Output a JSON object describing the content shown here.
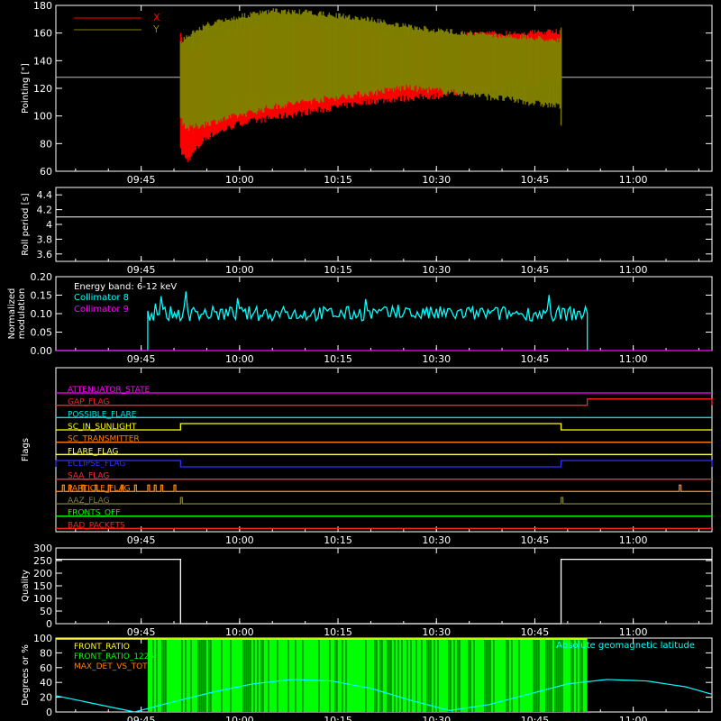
{
  "chart_data": [
    {
      "type": "line",
      "ylabel": "Pointing [\"]",
      "ylim": [
        60,
        180
      ],
      "yticks": [
        60,
        80,
        100,
        120,
        140,
        160,
        180
      ],
      "xlim": [
        "09:32",
        "11:12"
      ],
      "xticks": [
        "09:45",
        "10:00",
        "10:15",
        "10:30",
        "10:45",
        "11:00"
      ],
      "reference_line": 128,
      "legend_position": "top-left",
      "series": [
        {
          "name": "X",
          "color": "#ff0000",
          "x": [
            "09:51",
            "09:52",
            "09:55",
            "10:00",
            "10:10",
            "10:20",
            "10:25",
            "10:30",
            "10:40",
            "10:49"
          ],
          "high": [
            160,
            150,
            158,
            165,
            170,
            164,
            160,
            161,
            162,
            163
          ],
          "low": [
            72,
            65,
            82,
            92,
            100,
            108,
            110,
            112,
            118,
            123
          ]
        },
        {
          "name": "Y",
          "color": "#808000",
          "x": [
            "09:51",
            "09:52",
            "09:55",
            "10:00",
            "10:05",
            "10:10",
            "10:20",
            "10:25",
            "10:30",
            "10:40",
            "10:49"
          ],
          "high": [
            155,
            160,
            168,
            174,
            178,
            177,
            172,
            167,
            164,
            160,
            157
          ],
          "low": [
            96,
            88,
            92,
            98,
            104,
            108,
            114,
            118,
            116,
            110,
            104
          ]
        }
      ]
    },
    {
      "type": "line",
      "ylabel": "Roll period [s]",
      "ylim": [
        3.5,
        4.5
      ],
      "yticks": [
        3.6,
        3.8,
        4.0,
        4.2,
        4.4
      ],
      "xlim": [
        "09:32",
        "11:12"
      ],
      "xticks": [
        "09:45",
        "10:00",
        "10:15",
        "10:30",
        "10:45",
        "11:00"
      ],
      "series": [
        {
          "name": "",
          "color": "#ffffff",
          "x": [
            "09:32",
            "11:12"
          ],
          "y": [
            4.1,
            4.1
          ]
        }
      ]
    },
    {
      "type": "line",
      "ylabel_lines": [
        "Normalized",
        "modulation"
      ],
      "ylim": [
        0.0,
        0.2
      ],
      "yticks": [
        "0.00",
        "0.05",
        "0.10",
        "0.15",
        "0.20"
      ],
      "xlim": [
        "09:32",
        "11:12"
      ],
      "xticks": [
        "09:45",
        "10:00",
        "10:15",
        "10:30",
        "10:45",
        "11:00"
      ],
      "annotation": "Energy band: 6-12 keV",
      "legend_position": "top-left",
      "series": [
        {
          "name": "Collimator 8",
          "color": "#00ffff",
          "start": "09:46",
          "end": "10:53",
          "mean": 0.1,
          "spread": 0.04
        },
        {
          "name": "Collimator 9",
          "color": "#ff00ff",
          "y_constant": 0.0
        }
      ]
    },
    {
      "type": "line",
      "ylabel": "Flags",
      "xlim": [
        "09:32",
        "11:12"
      ],
      "xticks": [
        "09:45",
        "10:00",
        "10:15",
        "10:30",
        "10:45",
        "11:00"
      ],
      "flags": [
        {
          "name": "ATTENUATOR_STATE",
          "color": "#ff00ff",
          "steps": []
        },
        {
          "name": "GAP_FLAG",
          "color": "#ff2020",
          "steps": [
            {
              "from": "10:53",
              "to": "11:12"
            }
          ]
        },
        {
          "name": "POSSIBLE_FLARE",
          "color": "#00e0e0",
          "steps": []
        },
        {
          "name": "SC_IN_SUNLIGHT",
          "color": "#ffff00",
          "steps": [
            {
              "from": "09:51",
              "to": "10:49"
            }
          ]
        },
        {
          "name": "SC_TRANSMITTER",
          "color": "#ff8000",
          "steps": []
        },
        {
          "name": "FLARE_FLAG",
          "color": "#ffff60",
          "steps": []
        },
        {
          "name": "ECLIPSE_FLAG",
          "color": "#3030ff",
          "steps": [
            {
              "from": "09:32",
              "to": "09:51"
            },
            {
              "from": "10:49",
              "to": "11:12"
            }
          ]
        },
        {
          "name": "SAA_FLAG",
          "color": "#ff3030",
          "steps": []
        },
        {
          "name": "PARTICLE_FLAG",
          "color": "#ff8000",
          "pulse_times": [
            "09:33",
            "09:34",
            "09:36",
            "09:38",
            "09:40",
            "09:42",
            "09:44",
            "09:46",
            "09:47",
            "09:48",
            "09:50",
            "11:07"
          ]
        },
        {
          "name": "AAZ_FLAG",
          "color": "#808040",
          "pulse_times": [
            "09:51",
            "10:49"
          ]
        },
        {
          "name": "FRONTS_OFF",
          "color": "#00ff00",
          "steps": []
        },
        {
          "name": "BAD_PACKETS",
          "color": "#ff2020",
          "steps": []
        }
      ]
    },
    {
      "type": "line",
      "ylabel": "Quality",
      "ylim": [
        0,
        300
      ],
      "yticks": [
        0,
        50,
        100,
        150,
        200,
        250,
        300
      ],
      "xlim": [
        "09:32",
        "11:12"
      ],
      "xticks": [
        "09:45",
        "10:00",
        "10:15",
        "10:30",
        "10:45",
        "11:00"
      ],
      "series": [
        {
          "name": "",
          "color": "#ffffff",
          "x": [
            "09:32",
            "09:51",
            "09:51",
            "10:49",
            "10:49",
            "10:49",
            "11:12"
          ],
          "y": [
            255,
            255,
            0,
            0,
            30,
            255,
            255
          ]
        }
      ]
    },
    {
      "type": "line",
      "ylabel": "Degrees or %",
      "ylim": [
        0,
        100
      ],
      "yticks": [
        0,
        20,
        40,
        60,
        80,
        100
      ],
      "xlim": [
        "09:32",
        "11:12"
      ],
      "xticks": [
        "09:45",
        "10:00",
        "10:15",
        "10:30",
        "10:45",
        "11:00"
      ],
      "legend": [
        "FRONT_RATIO",
        "FRONT_RATIO_1225",
        "MAX_DET_VS_TOT"
      ],
      "legend_colors": [
        "#ffff00",
        "#00ff00",
        "#ff8000"
      ],
      "annotation": "Absolute geomagnetic latitude",
      "annotation_color": "#00ffff",
      "series": [
        {
          "name": "FRONT_RATIO_1225",
          "color": "#00ff00",
          "start": "09:46",
          "end": "10:53",
          "y": 100
        },
        {
          "name": "FRONT_RATIO",
          "color": "#ffff00",
          "start": "09:46",
          "end": "10:53",
          "y": 100
        },
        {
          "name": "Absolute geomagnetic latitude",
          "color": "#00ffff",
          "x": [
            "09:32",
            "09:38",
            "09:44",
            "09:50",
            "09:56",
            "10:02",
            "10:08",
            "10:14",
            "10:20",
            "10:26",
            "10:32",
            "10:38",
            "10:44",
            "10:50",
            "10:56",
            "11:02",
            "11:08",
            "11:12"
          ],
          "y": [
            22,
            11,
            0,
            14,
            27,
            38,
            44,
            42,
            32,
            16,
            2,
            10,
            24,
            38,
            44,
            42,
            34,
            24
          ]
        }
      ]
    }
  ]
}
